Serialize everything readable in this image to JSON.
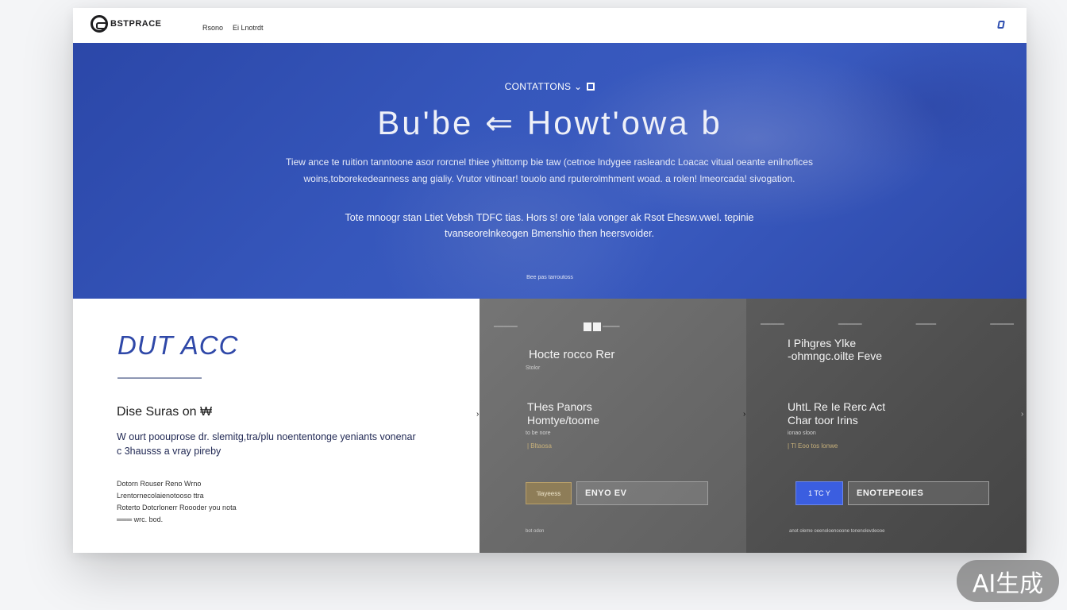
{
  "nav": {
    "logo_text": "BSTPRACE",
    "links": [
      "Rsono",
      "Ei Lnotrdt"
    ]
  },
  "hero": {
    "eyebrow": "CONTATTONS ⌄",
    "title": "Bu'be ⇐ Howt'owa b",
    "paragraph1": "Tiew ance te ruition tanntoone asor rorcnel thiee yhittomp bie taw (cetnoe lndygee rasleandc Loacac vitual oeante enilnofices woins,toborekedeanness ang gialiy. Vrutor  vitinoar! touolo and rputerolmhment  woad. a rolen! lmeorcada! sivogation.",
    "paragraph2": "Tote mnoogr stan Ltiet Vebsh TDFC tias. Hors s! ore 'lala vonger ak Rsot Ehesw.vwel. tepinie tvanseorelnkeogen Bmenshio then heersvoider.",
    "link": "Bee pas tarroutoss"
  },
  "left_panel": {
    "title": "DUT ACC",
    "subtitle": "Dise Suras  on ₩",
    "description": "W ourt  poouprose dr. slemitg,tra/plu noententonge yeniants vonenar c 3hausss a vray pireby",
    "list": [
      "Dotorn  Rouser  Reno Wrno",
      "Lrentornecolaienotooso  ttra",
      "Roterto  Dotcrlonerr Roooder you nota",
      "═══  wrc. bod."
    ]
  },
  "panel_mid": {
    "top_left": "═══════",
    "top_chip": "═════",
    "top_right": "",
    "heading1": "Hocte rocco Rer",
    "small1": "Stolor",
    "heading2": "THes Panors\nHomtye/toome",
    "small2": "to be nore",
    "yellow": "| Bltaosa",
    "btn_label": "'ilayeess",
    "field_label": "ENYO EV",
    "foot": "bot odon"
  },
  "panel_right": {
    "top_items": [
      "═══════",
      "═══════",
      "══════",
      "═══════"
    ],
    "heading1": "I Pihgres Ylke\n-ohmngc.oilte Feve",
    "heading2": "UhtL Re  Ie Rerc Act\nChar toor Irins",
    "small2": "ionao sloon",
    "yellow": "| Tl Eoo tos lonwe",
    "btn_label": "1 TC Y",
    "field_label": "ENOTEPEOIES",
    "foot": "anot oleme oeenoloenooone tonenolevdeooe"
  },
  "badge": "AI生成",
  "colors": {
    "hero_blue": "#3657bc",
    "accent_blue": "#2f48a8",
    "button_blue": "#3b5ee0",
    "gold": "#8e7d58"
  }
}
